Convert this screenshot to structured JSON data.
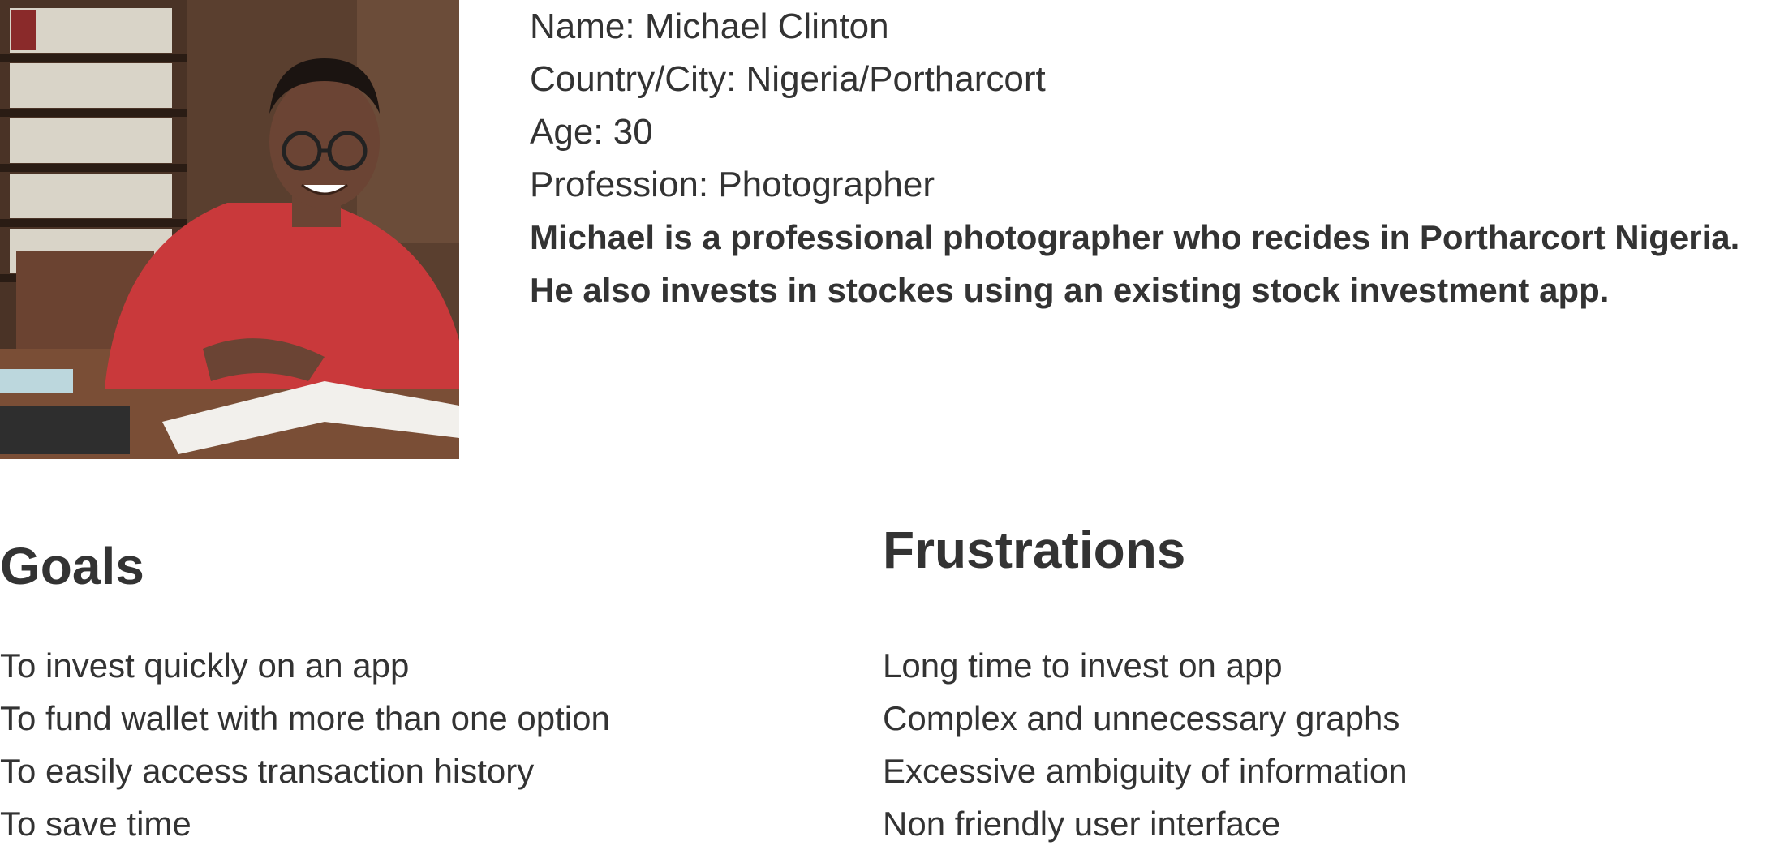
{
  "persona": {
    "photo_description": "smiling man in red sweater with glasses at desk",
    "name_line": "Name: Michael Clinton",
    "location_line": "Country/City: Nigeria/Portharcort",
    "age_line": "Age: 30",
    "profession_line": "Profession: Photographer",
    "bio_line_1": "Michael is a professional photographer who recides in Portharcort Nigeria.",
    "bio_line_2": "He also invests in stockes using an existing stock investment app."
  },
  "goals": {
    "title": "Goals",
    "items": [
      "To invest quickly on an app",
      "To fund wallet with more than one option",
      "To easily access transaction history",
      "To save time"
    ]
  },
  "frustrations": {
    "title": "Frustrations",
    "items": [
      "Long time to invest on app",
      "Complex and unnecessary graphs",
      "Excessive ambiguity of information",
      "Non friendly user interface"
    ]
  }
}
